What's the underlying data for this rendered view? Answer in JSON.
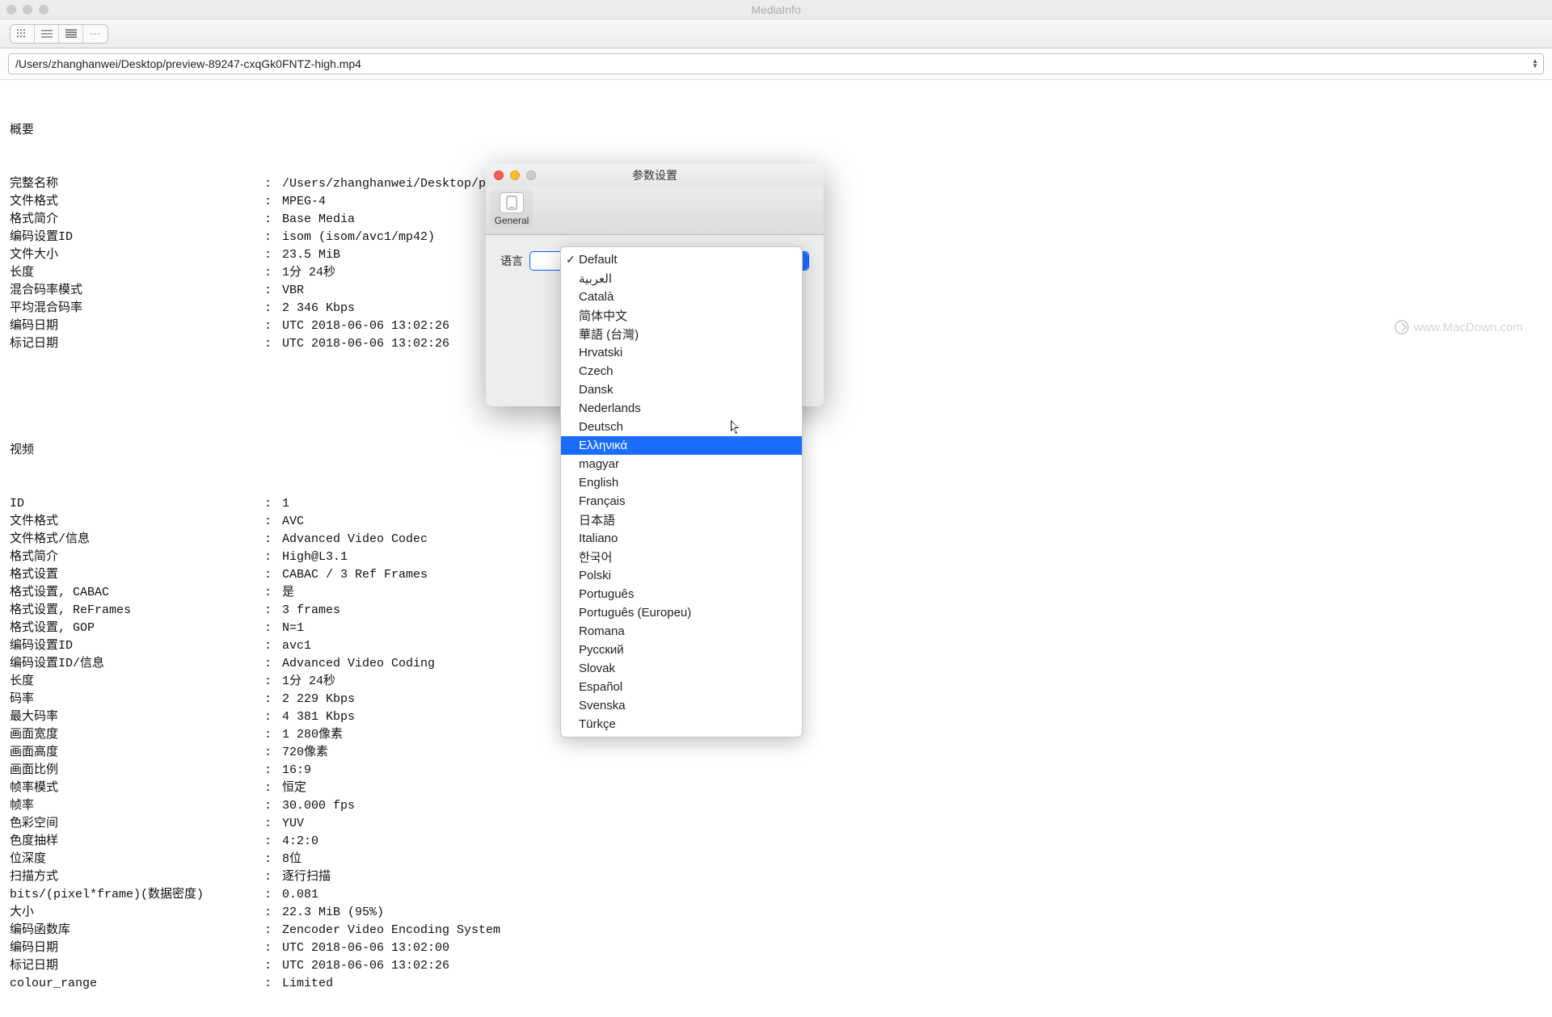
{
  "window": {
    "title": "MediaInfo"
  },
  "path": "/Users/zhanghanwei/Desktop/preview-89247-cxqGk0FNTZ-high.mp4",
  "sections": {
    "general": {
      "header": "概要",
      "rows": [
        {
          "label": "完整名称",
          "value": "/Users/zhanghanwei/Desktop/preview-89247-cxqGk0FNTZ-high.mp4"
        },
        {
          "label": "文件格式",
          "value": "MPEG-4"
        },
        {
          "label": "格式简介",
          "value": "Base Media"
        },
        {
          "label": "编码设置ID",
          "value": "isom (isom/avc1/mp42)"
        },
        {
          "label": "文件大小",
          "value": "23.5 MiB"
        },
        {
          "label": "长度",
          "value": "1分 24秒"
        },
        {
          "label": "混合码率模式",
          "value": "VBR"
        },
        {
          "label": "平均混合码率",
          "value": "2 346 Kbps"
        },
        {
          "label": "编码日期",
          "value": "UTC 2018-06-06 13:02:26"
        },
        {
          "label": "标记日期",
          "value": "UTC 2018-06-06 13:02:26"
        }
      ]
    },
    "video": {
      "header": "视频",
      "rows": [
        {
          "label": "ID",
          "value": "1"
        },
        {
          "label": "文件格式",
          "value": "AVC"
        },
        {
          "label": "文件格式/信息",
          "value": "Advanced Video Codec"
        },
        {
          "label": "格式简介",
          "value": "High@L3.1"
        },
        {
          "label": "格式设置",
          "value": "CABAC / 3 Ref Frames"
        },
        {
          "label": "格式设置, CABAC",
          "value": "是"
        },
        {
          "label": "格式设置, ReFrames",
          "value": "3 frames"
        },
        {
          "label": "格式设置, GOP",
          "value": "N=1"
        },
        {
          "label": "编码设置ID",
          "value": "avc1"
        },
        {
          "label": "编码设置ID/信息",
          "value": "Advanced Video Coding"
        },
        {
          "label": "长度",
          "value": "1分 24秒"
        },
        {
          "label": "码率",
          "value": "2 229 Kbps"
        },
        {
          "label": "最大码率",
          "value": "4 381 Kbps"
        },
        {
          "label": "画面宽度",
          "value": "1 280像素"
        },
        {
          "label": "画面高度",
          "value": "720像素"
        },
        {
          "label": "画面比例",
          "value": "16:9"
        },
        {
          "label": "帧率模式",
          "value": "恒定"
        },
        {
          "label": "帧率",
          "value": "30.000 fps"
        },
        {
          "label": "色彩空间",
          "value": "YUV"
        },
        {
          "label": "色度抽样",
          "value": "4:2:0"
        },
        {
          "label": "位深度",
          "value": "8位"
        },
        {
          "label": "扫描方式",
          "value": "逐行扫描"
        },
        {
          "label": "bits/(pixel*frame)(数据密度)",
          "value": "0.081"
        },
        {
          "label": "大小",
          "value": "22.3 MiB (95%)"
        },
        {
          "label": "编码函数库",
          "value": "Zencoder Video Encoding System"
        },
        {
          "label": "编码日期",
          "value": "UTC 2018-06-06 13:02:00"
        },
        {
          "label": "标记日期",
          "value": "UTC 2018-06-06 13:02:26"
        },
        {
          "label": "colour_range",
          "value": "Limited"
        }
      ]
    }
  },
  "prefs": {
    "title": "参数设置",
    "tabs": {
      "general": "General"
    },
    "language_label": "语言"
  },
  "language_options": [
    {
      "label": "Default",
      "checked": true
    },
    {
      "label": "العربية"
    },
    {
      "label": "Català"
    },
    {
      "label": "简体中文"
    },
    {
      "label": "華語 (台灣)"
    },
    {
      "label": "Hrvatski"
    },
    {
      "label": "Czech"
    },
    {
      "label": "Dansk"
    },
    {
      "label": "Nederlands"
    },
    {
      "label": "Deutsch"
    },
    {
      "label": "Ελληνικά",
      "highlight": true
    },
    {
      "label": "magyar"
    },
    {
      "label": "English"
    },
    {
      "label": "Français"
    },
    {
      "label": "日本語"
    },
    {
      "label": "Italiano"
    },
    {
      "label": "한국어"
    },
    {
      "label": "Polski"
    },
    {
      "label": "Português"
    },
    {
      "label": "Português (Europeu)"
    },
    {
      "label": "Romana"
    },
    {
      "label": "Русский"
    },
    {
      "label": "Slovak"
    },
    {
      "label": "Español"
    },
    {
      "label": "Svenska"
    },
    {
      "label": "Türkçe"
    }
  ],
  "watermark": "www.MacDown.com"
}
